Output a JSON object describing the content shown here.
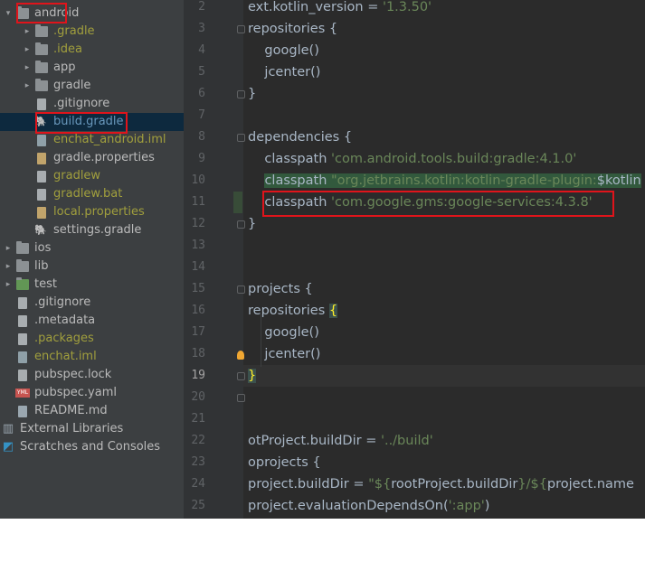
{
  "project_tree": {
    "items": [
      {
        "label": "android",
        "icon": "folder-icon",
        "arrow": "▾",
        "color": "#bbbbbb"
      },
      {
        "label": ".gradle",
        "icon": "folder-icon",
        "arrow": "▸",
        "color": "#a19f3d"
      },
      {
        "label": ".idea",
        "icon": "folder-settings-icon",
        "arrow": "▸",
        "color": "#a19f3d"
      },
      {
        "label": "app",
        "icon": "folder-icon",
        "arrow": "▸",
        "color": "#bbbbbb"
      },
      {
        "label": "gradle",
        "icon": "folder-icon",
        "arrow": "▸",
        "color": "#bbbbbb"
      },
      {
        "label": ".gitignore",
        "icon": "file-icon",
        "arrow": "",
        "color": "#bbbbbb"
      },
      {
        "label": "build.gradle",
        "icon": "gradle-icon",
        "arrow": "",
        "color": "#6897bb"
      },
      {
        "label": "enchat_android.iml",
        "icon": "iml-file-icon",
        "arrow": "",
        "color": "#a19f3d"
      },
      {
        "label": "gradle.properties",
        "icon": "properties-file-icon",
        "arrow": "",
        "color": "#bbbbbb"
      },
      {
        "label": "gradlew",
        "icon": "file-icon",
        "arrow": "",
        "color": "#a19f3d"
      },
      {
        "label": "gradlew.bat",
        "icon": "file-icon",
        "arrow": "",
        "color": "#a19f3d"
      },
      {
        "label": "local.properties",
        "icon": "properties-file-icon",
        "arrow": "",
        "color": "#a19f3d"
      },
      {
        "label": "settings.gradle",
        "icon": "gradle-icon",
        "arrow": "",
        "color": "#bbbbbb"
      },
      {
        "label": "ios",
        "icon": "folder-icon",
        "arrow": "▸",
        "color": "#bbbbbb"
      },
      {
        "label": "lib",
        "icon": "folder-icon",
        "arrow": "▸",
        "color": "#bbbbbb"
      },
      {
        "label": "test",
        "icon": "folder-test-icon",
        "arrow": "▸",
        "color": "#bbbbbb"
      },
      {
        "label": ".gitignore",
        "icon": "file-icon",
        "arrow": "",
        "color": "#bbbbbb"
      },
      {
        "label": ".metadata",
        "icon": "file-icon",
        "arrow": "",
        "color": "#bbbbbb"
      },
      {
        "label": ".packages",
        "icon": "file-icon",
        "arrow": "",
        "color": "#a19f3d"
      },
      {
        "label": "enchat.iml",
        "icon": "iml-file-icon",
        "arrow": "",
        "color": "#a19f3d"
      },
      {
        "label": "pubspec.lock",
        "icon": "file-icon",
        "arrow": "",
        "color": "#bbbbbb"
      },
      {
        "label": "pubspec.yaml",
        "icon": "yaml-file-icon",
        "arrow": "",
        "color": "#bbbbbb"
      },
      {
        "label": "README.md",
        "icon": "markdown-file-icon",
        "arrow": "",
        "color": "#bbbbbb"
      },
      {
        "label": "External Libraries",
        "icon": "libraries-icon",
        "arrow": "",
        "color": "#bbbbbb"
      },
      {
        "label": "Scratches and Consoles",
        "icon": "scratches-icon",
        "arrow": "",
        "color": "#bbbbbb"
      }
    ],
    "yaml_badge": "YML"
  },
  "editor": {
    "line_numbers": [
      "2",
      "3",
      "4",
      "5",
      "6",
      "7",
      "8",
      "9",
      "10",
      "11",
      "12",
      "13",
      "14",
      "15",
      "16",
      "17",
      "18",
      "19",
      "20",
      "21",
      "22",
      "23",
      "24",
      "25"
    ],
    "current_line": "19",
    "lines": [
      {
        "n": "2",
        "code": [
          {
            "t": "ext.kotlin_version = "
          },
          {
            "t": "'1.3.50'",
            "c": "str"
          }
        ]
      },
      {
        "n": "3",
        "code": [
          {
            "t": "repositories "
          },
          {
            "t": "{"
          }
        ]
      },
      {
        "n": "4",
        "code": [
          {
            "t": "    google()"
          }
        ]
      },
      {
        "n": "5",
        "code": [
          {
            "t": "    jcenter()"
          }
        ]
      },
      {
        "n": "6",
        "code": [
          {
            "t": "}"
          }
        ]
      },
      {
        "n": "7",
        "code": []
      },
      {
        "n": "8",
        "code": [
          {
            "t": "dependencies "
          },
          {
            "t": "{"
          }
        ]
      },
      {
        "n": "9",
        "code": [
          {
            "t": "    classpath "
          },
          {
            "t": "'com.android.tools.build:gradle:4.1.0'",
            "c": "str"
          }
        ]
      },
      {
        "n": "10",
        "code": [
          {
            "t": "    "
          },
          {
            "t": "classpath ",
            "c": "hl"
          },
          {
            "t": "\"org.jetbrains.kotlin:kotlin-gradle-plugin:",
            "c": "str hl"
          },
          {
            "t": "$kotlin",
            "c": "hl"
          }
        ]
      },
      {
        "n": "11",
        "code": [
          {
            "t": "    classpath "
          },
          {
            "t": "'com.google.gms:google-services:4.3.8'",
            "c": "str"
          }
        ]
      },
      {
        "n": "12",
        "code": [
          {
            "t": "}"
          }
        ]
      },
      {
        "n": "13",
        "code": []
      },
      {
        "n": "14",
        "code": []
      },
      {
        "n": "15",
        "code": [
          {
            "t": "projects "
          },
          {
            "t": "{"
          }
        ]
      },
      {
        "n": "16",
        "code": [
          {
            "t": "repositories "
          },
          {
            "t": "{",
            "c": "brace"
          }
        ]
      },
      {
        "n": "17",
        "code": [
          {
            "t": "    google()"
          }
        ]
      },
      {
        "n": "18",
        "code": [
          {
            "t": "    jcenter()"
          }
        ]
      },
      {
        "n": "19",
        "code": [
          {
            "t": "}",
            "c": "brace"
          }
        ]
      },
      {
        "n": "20",
        "code": []
      },
      {
        "n": "21",
        "code": []
      },
      {
        "n": "22",
        "code": [
          {
            "t": "otProject.buildDir = "
          },
          {
            "t": "'../build'",
            "c": "str"
          }
        ]
      },
      {
        "n": "23",
        "code": [
          {
            "t": "oprojects "
          },
          {
            "t": "{"
          }
        ]
      },
      {
        "n": "24",
        "code": [
          {
            "t": "project.buildDir = "
          },
          {
            "t": "\"${",
            "c": "str"
          },
          {
            "t": "rootProject.buildDir"
          },
          {
            "t": "}/${",
            "c": "str"
          },
          {
            "t": "project.name"
          }
        ]
      },
      {
        "n": "25",
        "code": [
          {
            "t": "project.evaluationDependsOn("
          },
          {
            "t": "':app'",
            "c": "str"
          },
          {
            "t": ")"
          }
        ]
      }
    ]
  },
  "colors": {
    "tree_bg": "#3c3f41",
    "editor_bg": "#2b2b2b",
    "gutter_bg": "#313335",
    "selection": "#0d293e",
    "annotation_red": "#e0141b",
    "string": "#6a8759",
    "code_text": "#a9b7c6"
  }
}
